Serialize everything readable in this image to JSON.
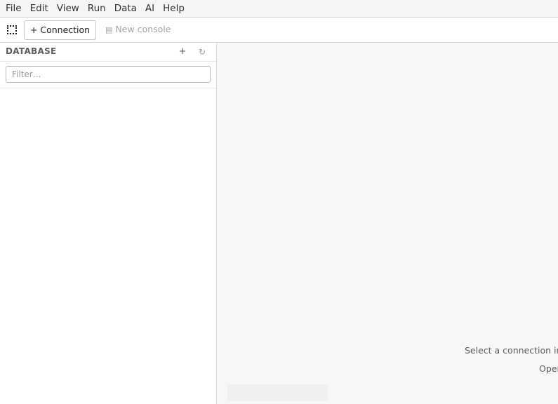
{
  "menubar": {
    "items": [
      "File",
      "Edit",
      "View",
      "Run",
      "Data",
      "AI",
      "Help"
    ]
  },
  "toolbar": {
    "app_icon": "dotted-square-icon",
    "connection_label": "+ Connection",
    "new_console_icon": "console-icon",
    "new_console_label": "New console"
  },
  "sidebar": {
    "title": "DATABASE",
    "add_icon_glyph": "+",
    "refresh_icon_glyph": "↻",
    "filter_placeholder": "Filter…",
    "filter_value": ""
  },
  "main": {
    "hint_line_1": "Select a connection in",
    "hint_line_2": "Oper"
  }
}
